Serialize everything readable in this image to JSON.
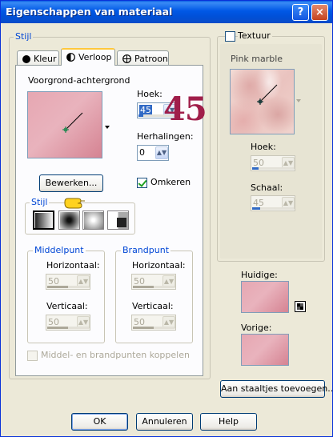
{
  "window": {
    "title": "Eigenschappen van materiaal",
    "help_glyph": "?",
    "close_glyph": "×"
  },
  "stijl_group": {
    "label": "Stijl"
  },
  "tabs": [
    {
      "label": "Kleur"
    },
    {
      "label": "Verloop"
    },
    {
      "label": "Patroon"
    }
  ],
  "gradient": {
    "name": "Voorgrond-achtergrond",
    "hoek_label": "Hoek:",
    "hoek_value": "45",
    "hoek_fraction": 0.125,
    "herhalingen_label": "Herhalingen:",
    "herhalingen_value": "0",
    "bewerken_label": "Bewerken...",
    "omkeren_label": "Omkeren",
    "omkeren_checked": true,
    "annotation": "45"
  },
  "stijl_sub": {
    "label": "Stijl"
  },
  "middelpunt": {
    "label": "Middelpunt",
    "horizontaal_label": "Horizontaal:",
    "horizontaal_value": "50",
    "verticaal_label": "Verticaal:",
    "verticaal_value": "50"
  },
  "brandpunt": {
    "label": "Brandpunt",
    "horizontaal_label": "Horizontaal:",
    "horizontaal_value": "50",
    "verticaal_label": "Verticaal:",
    "verticaal_value": "50"
  },
  "koppelen": {
    "label": "Middel- en brandpunten koppelen"
  },
  "textuur": {
    "label": "Textuur",
    "name": "Pink marble",
    "hoek_label": "Hoek:",
    "hoek_value": "50",
    "schaal_label": "Schaal:",
    "schaal_value": "45"
  },
  "huidige": {
    "label": "Huidige:"
  },
  "vorige": {
    "label": "Vorige:"
  },
  "buttons": {
    "add_swatch": "Aan staaltjes toevoegen...",
    "ok": "OK",
    "cancel": "Annuleren",
    "help": "Help"
  },
  "colors": {
    "accent": "#0046D5",
    "gradient_start": "#E6A7B2",
    "gradient_end": "#D58392"
  }
}
